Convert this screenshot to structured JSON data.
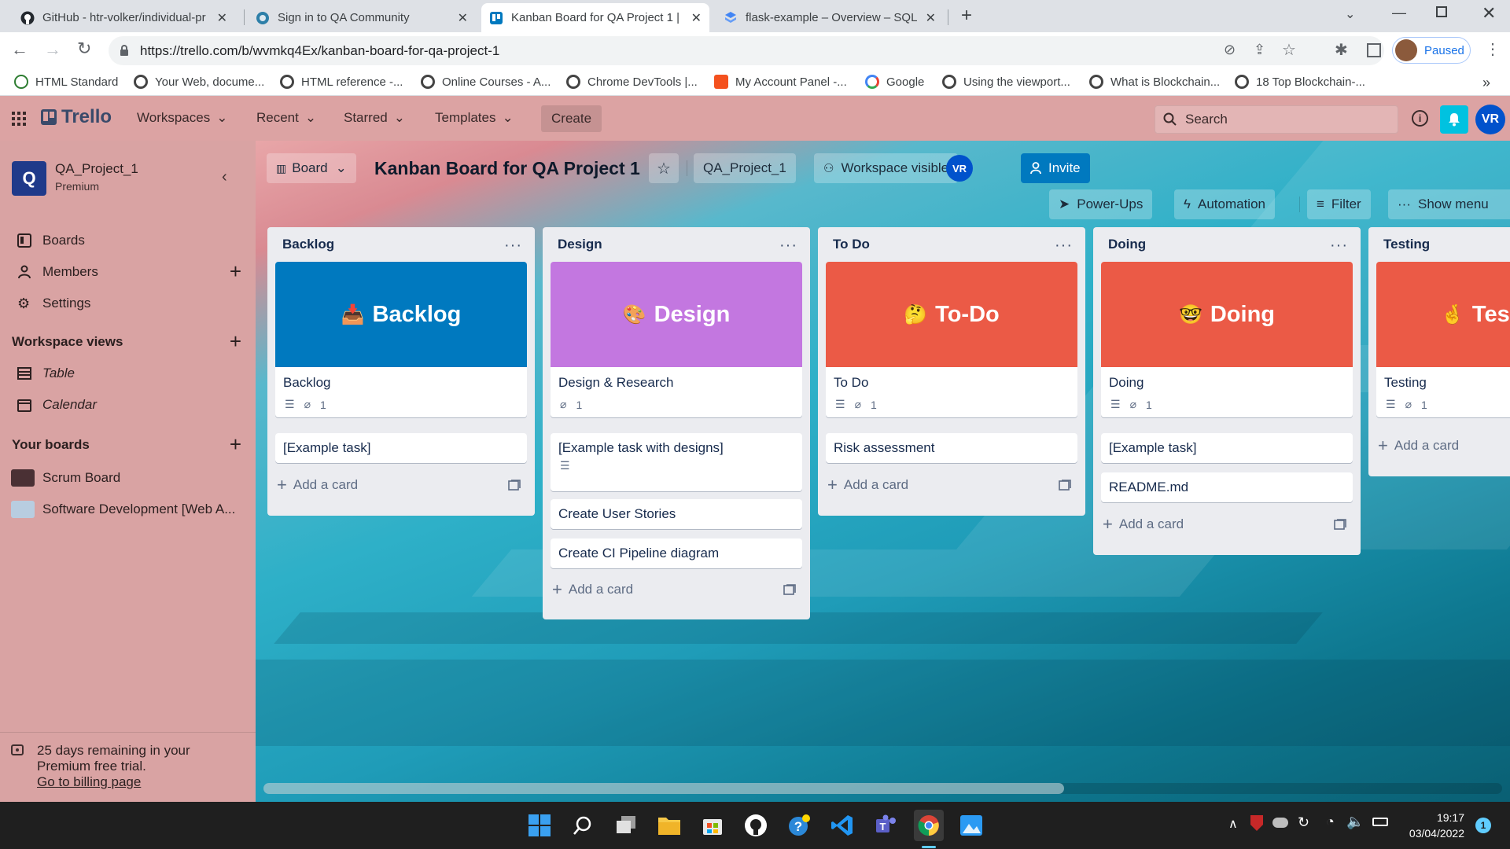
{
  "browser": {
    "tabs": [
      {
        "title": "GitHub - htr-volker/individual-pr",
        "active": false
      },
      {
        "title": "Sign in to QA Community",
        "active": false
      },
      {
        "title": "Kanban Board for QA Project 1 | ",
        "active": true
      },
      {
        "title": "flask-example – Overview – SQL ",
        "active": false
      }
    ],
    "new_tab": "+",
    "url": "https://trello.com/b/wvmkq4Ex/kanban-board-for-qa-project-1",
    "profile_status": "Paused",
    "bookmarks": [
      "HTML Standard",
      "Your Web, docume...",
      "HTML reference -...",
      "Online Courses - A...",
      "Chrome DevTools |...",
      "My Account Panel -...",
      "Google",
      "Using the viewport...",
      "What is Blockchain...",
      "18 Top Blockchain-..."
    ],
    "bookmarks_more": "»"
  },
  "header": {
    "logo": "Trello",
    "nav": [
      "Workspaces",
      "Recent",
      "Starred",
      "Templates"
    ],
    "create": "Create",
    "search_placeholder": "Search",
    "avatar": "VR",
    "colors": {
      "header_bg": "#dca3a3",
      "bell_bg": "#00c2e0",
      "avatar_bg": "#0052cc"
    }
  },
  "sidebar": {
    "workspace_initial": "Q",
    "workspace_name": "QA_Project_1",
    "workspace_plan": "Premium",
    "items": [
      {
        "label": "Boards"
      },
      {
        "label": "Members"
      },
      {
        "label": "Settings"
      }
    ],
    "views_heading": "Workspace views",
    "views": [
      {
        "label": "Table"
      },
      {
        "label": "Calendar"
      }
    ],
    "boards_heading": "Your boards",
    "boards": [
      {
        "label": "Scrum Board"
      },
      {
        "label": "Software Development [Web A..."
      }
    ],
    "trial_text_line1": "25 days remaining in your",
    "trial_text_line2": "Premium free trial.",
    "billing_link": "Go to billing page"
  },
  "board": {
    "view_button": "Board",
    "title": "Kanban Board for QA Project 1",
    "workspace_button": "QA_Project_1",
    "visibility_button": "Workspace visible",
    "member_avatar": "VR",
    "invite": "Invite",
    "powerups": "Power-Ups",
    "automation": "Automation",
    "filter": "Filter",
    "show_menu": "Show menu",
    "add_card": "Add a card",
    "lists": [
      {
        "name": "Backlog",
        "cover": {
          "emoji": "📥",
          "text": "Backlog",
          "color": "#0079bf"
        },
        "cover_card_title": "Backlog",
        "attachments": "1",
        "cards": [
          "[Example task]"
        ]
      },
      {
        "name": "Design",
        "cover": {
          "emoji": "🎨",
          "text": "Design",
          "color": "#c377e0"
        },
        "cover_card_title": "Design & Research",
        "attachments": "1",
        "cards": [
          "[Example task with designs]",
          "Create User Stories",
          "Create CI Pipeline diagram"
        ]
      },
      {
        "name": "To Do",
        "cover": {
          "emoji": "🤔",
          "text": "To-Do",
          "color": "#eb5a46"
        },
        "cover_card_title": "To Do",
        "attachments": "1",
        "cards": [
          "Risk assessment"
        ]
      },
      {
        "name": "Doing",
        "cover": {
          "emoji": "🤓",
          "text": "Doing",
          "color": "#eb5a46"
        },
        "cover_card_title": "Doing",
        "attachments": "1",
        "cards": [
          "[Example task]",
          "README.md"
        ]
      },
      {
        "name": "Testing",
        "cover": {
          "emoji": "🤞",
          "text": "Test",
          "color": "#eb5a46"
        },
        "cover_card_title": "Testing",
        "attachments": "1",
        "cards": []
      }
    ]
  },
  "taskbar": {
    "time": "19:17",
    "date": "03/04/2022",
    "notifications": "1"
  }
}
